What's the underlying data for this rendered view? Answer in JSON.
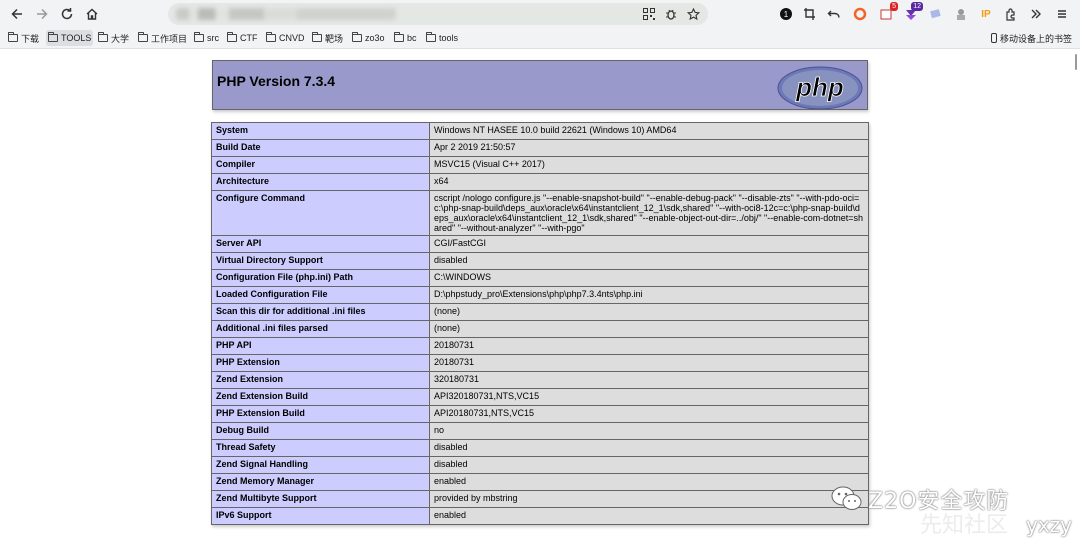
{
  "bookmarks": [
    {
      "label": "下载"
    },
    {
      "label": "TOOLS",
      "active": true
    },
    {
      "label": "大学"
    },
    {
      "label": "工作项目"
    },
    {
      "label": "src"
    },
    {
      "label": "CTF"
    },
    {
      "label": "CNVD"
    },
    {
      "label": "靶场"
    },
    {
      "label": "zo3o"
    },
    {
      "label": "bc"
    },
    {
      "label": "tools"
    }
  ],
  "mobile_bookmarks": "移动设备上的书签",
  "extensions": {
    "badge_red": "5",
    "badge_purple": "12",
    "ip_label": "IP"
  },
  "icons": [
    "back-arrow-icon",
    "forward-arrow-icon",
    "reload-icon",
    "home-icon",
    "qr-code-icon",
    "bug-icon",
    "star-icon",
    "extensions-icon",
    "menu-icon"
  ],
  "phpinfo": {
    "title": "PHP Version 7.3.4",
    "logo_text": "php",
    "rows": [
      {
        "key": "System",
        "value": "Windows NT HASEE 10.0 build 22621 (Windows 10) AMD64"
      },
      {
        "key": "Build Date",
        "value": "Apr 2 2019 21:50:57"
      },
      {
        "key": "Compiler",
        "value": "MSVC15 (Visual C++ 2017)"
      },
      {
        "key": "Architecture",
        "value": "x64"
      },
      {
        "key": "Configure Command",
        "value": "cscript /nologo configure.js \"--enable-snapshot-build\" \"--enable-debug-pack\" \"--disable-zts\" \"--with-pdo-oci=c:\\php-snap-build\\deps_aux\\oracle\\x64\\instantclient_12_1\\sdk,shared\" \"--with-oci8-12c=c:\\php-snap-build\\deps_aux\\oracle\\x64\\instantclient_12_1\\sdk,shared\" \"--enable-object-out-dir=../obj/\" \"--enable-com-dotnet=shared\" \"--without-analyzer\" \"--with-pgo\""
      },
      {
        "key": "Server API",
        "value": "CGI/FastCGI"
      },
      {
        "key": "Virtual Directory Support",
        "value": "disabled"
      },
      {
        "key": "Configuration File (php.ini) Path",
        "value": "C:\\WINDOWS"
      },
      {
        "key": "Loaded Configuration File",
        "value": "D:\\phpstudy_pro\\Extensions\\php\\php7.3.4nts\\php.ini"
      },
      {
        "key": "Scan this dir for additional .ini files",
        "value": "(none)"
      },
      {
        "key": "Additional .ini files parsed",
        "value": "(none)"
      },
      {
        "key": "PHP API",
        "value": "20180731"
      },
      {
        "key": "PHP Extension",
        "value": "20180731"
      },
      {
        "key": "Zend Extension",
        "value": "320180731"
      },
      {
        "key": "Zend Extension Build",
        "value": "API320180731,NTS,VC15"
      },
      {
        "key": "PHP Extension Build",
        "value": "API20180731,NTS,VC15"
      },
      {
        "key": "Debug Build",
        "value": "no"
      },
      {
        "key": "Thread Safety",
        "value": "disabled"
      },
      {
        "key": "Zend Signal Handling",
        "value": "disabled"
      },
      {
        "key": "Zend Memory Manager",
        "value": "enabled"
      },
      {
        "key": "Zend Multibyte Support",
        "value": "provided by mbstring"
      },
      {
        "key": "IPv6 Support",
        "value": "enabled"
      }
    ]
  },
  "watermark": {
    "main": "Z2O安全攻防",
    "sub": "yxzy",
    "bg": "先知社区"
  }
}
